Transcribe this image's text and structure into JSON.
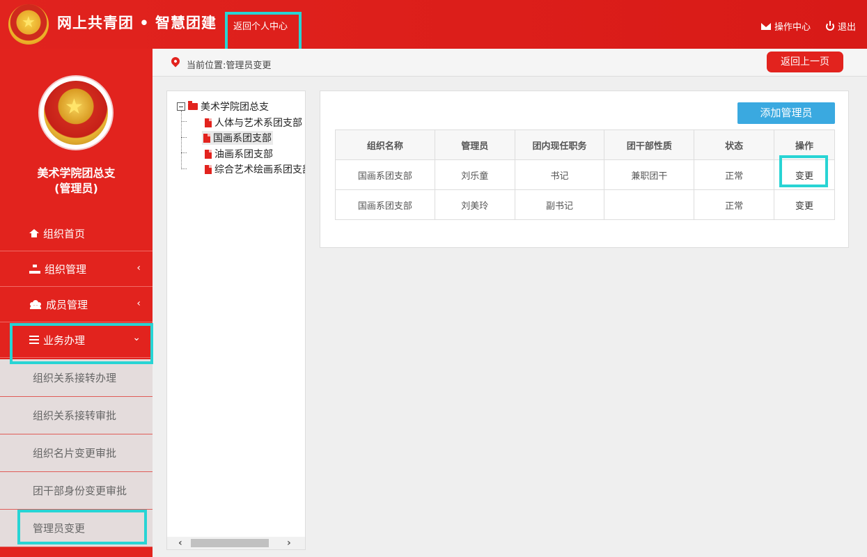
{
  "header": {
    "site_title": "网上共青团 • 智慧团建",
    "back_center": "返回个人中心",
    "ops_center": "操作中心",
    "logout": "退出"
  },
  "sidebar": {
    "org_name_line1": "美术学院团总支",
    "org_name_line2": "(管理员)",
    "menu": [
      {
        "label": "组织首页",
        "icon": "home-icon"
      },
      {
        "label": "组织管理",
        "icon": "sitemap-icon"
      },
      {
        "label": "成员管理",
        "icon": "users-icon"
      },
      {
        "label": "业务办理",
        "icon": "bars-icon"
      }
    ],
    "submenu": [
      {
        "label": "组织关系接转办理"
      },
      {
        "label": "组织关系接转审批"
      },
      {
        "label": "组织名片变更审批"
      },
      {
        "label": "团干部身份变更审批"
      },
      {
        "label": "管理员变更"
      }
    ]
  },
  "breadcrumb": {
    "text": "当前位置:管理员变更",
    "back_button": "返回上一页"
  },
  "tree": {
    "root": "美术学院团总支",
    "children": [
      "人体与艺术系团支部",
      "国画系团支部",
      "油画系团支部",
      "综合艺术绘画系团支部"
    ],
    "selected_index": 1
  },
  "content": {
    "add_button": "添加管理员",
    "table": {
      "headers": [
        "组织名称",
        "管理员",
        "团内现任职务",
        "团干部性质",
        "状态",
        "操作"
      ],
      "rows": [
        [
          "国画系团支部",
          "刘乐童",
          "书记",
          "兼职团干",
          "正常",
          "变更"
        ],
        [
          "国画系团支部",
          "刘美玲",
          "副书记",
          "",
          "正常",
          "变更"
        ]
      ]
    }
  },
  "colors": {
    "brand_red": "#e2231e",
    "highlight": "#28d4d4",
    "button_blue": "#3aa9e0"
  }
}
